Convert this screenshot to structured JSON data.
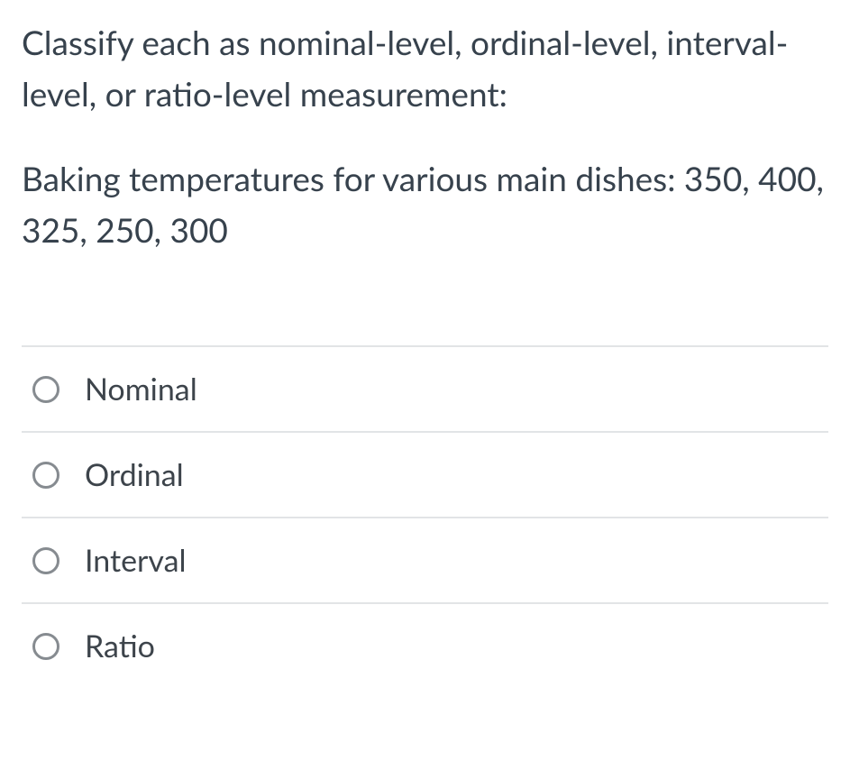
{
  "question": {
    "prompt": "Classify each as nominal-level, ordinal-level, interval-level, or ratio-level measurement:",
    "detail": "Baking temperatures for various main dishes: 350, 400, 325, 250, 300"
  },
  "options": [
    {
      "label": "Nominal"
    },
    {
      "label": "Ordinal"
    },
    {
      "label": "Interval"
    },
    {
      "label": "Ratio"
    }
  ]
}
